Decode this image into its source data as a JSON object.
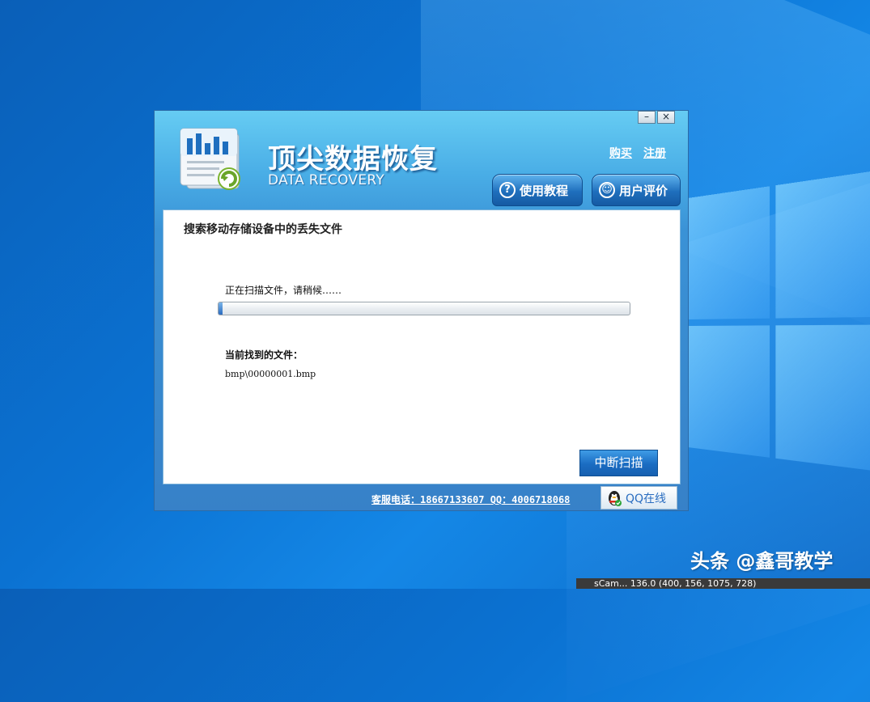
{
  "window": {
    "title_cn": "顶尖数据恢复",
    "title_en": "DATA RECOVERY",
    "controls": {
      "minimize": "–",
      "close": "×"
    },
    "links": {
      "buy": "购买",
      "register": "注册"
    },
    "tabs": [
      {
        "label": "使用教程",
        "icon": "question-icon"
      },
      {
        "label": "用户评价",
        "icon": "review-icon"
      }
    ]
  },
  "scan": {
    "heading": "搜索移动存储设备中的丢失文件",
    "status_message": "正在扫描文件，请稍候……",
    "progress_percent": 1,
    "found_label": "当前找到的文件：",
    "found_file": "bmp\\00000001.bmp",
    "stop_button": "中断扫描"
  },
  "footer": {
    "contact": "客服电话：18667133607 QQ：4006718068",
    "qq_button": "QQ在线"
  },
  "desktop": {
    "watermark": "头条 @鑫哥教学",
    "status_tip": "sCam... 136.0 (400, 156, 1075, 728)"
  }
}
